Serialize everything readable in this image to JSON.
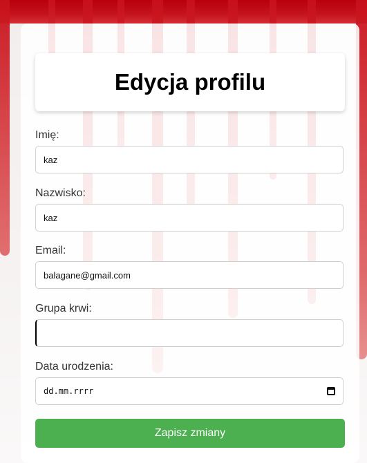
{
  "page": {
    "title": "Edycja profilu"
  },
  "form": {
    "first_name": {
      "label": "Imię:",
      "value": "kaz"
    },
    "last_name": {
      "label": "Nazwisko:",
      "value": "kaz"
    },
    "email": {
      "label": "Email:",
      "value": "balagane@gmail.com"
    },
    "blood_group": {
      "label": "Grupa krwi:",
      "value": ""
    },
    "birth_date": {
      "label": "Data urodzenia:",
      "placeholder": "dd.mm.rrrr"
    },
    "submit_label": "Zapisz zmiany"
  },
  "colors": {
    "submit": "#4caf50",
    "blood": "#c8101a"
  }
}
